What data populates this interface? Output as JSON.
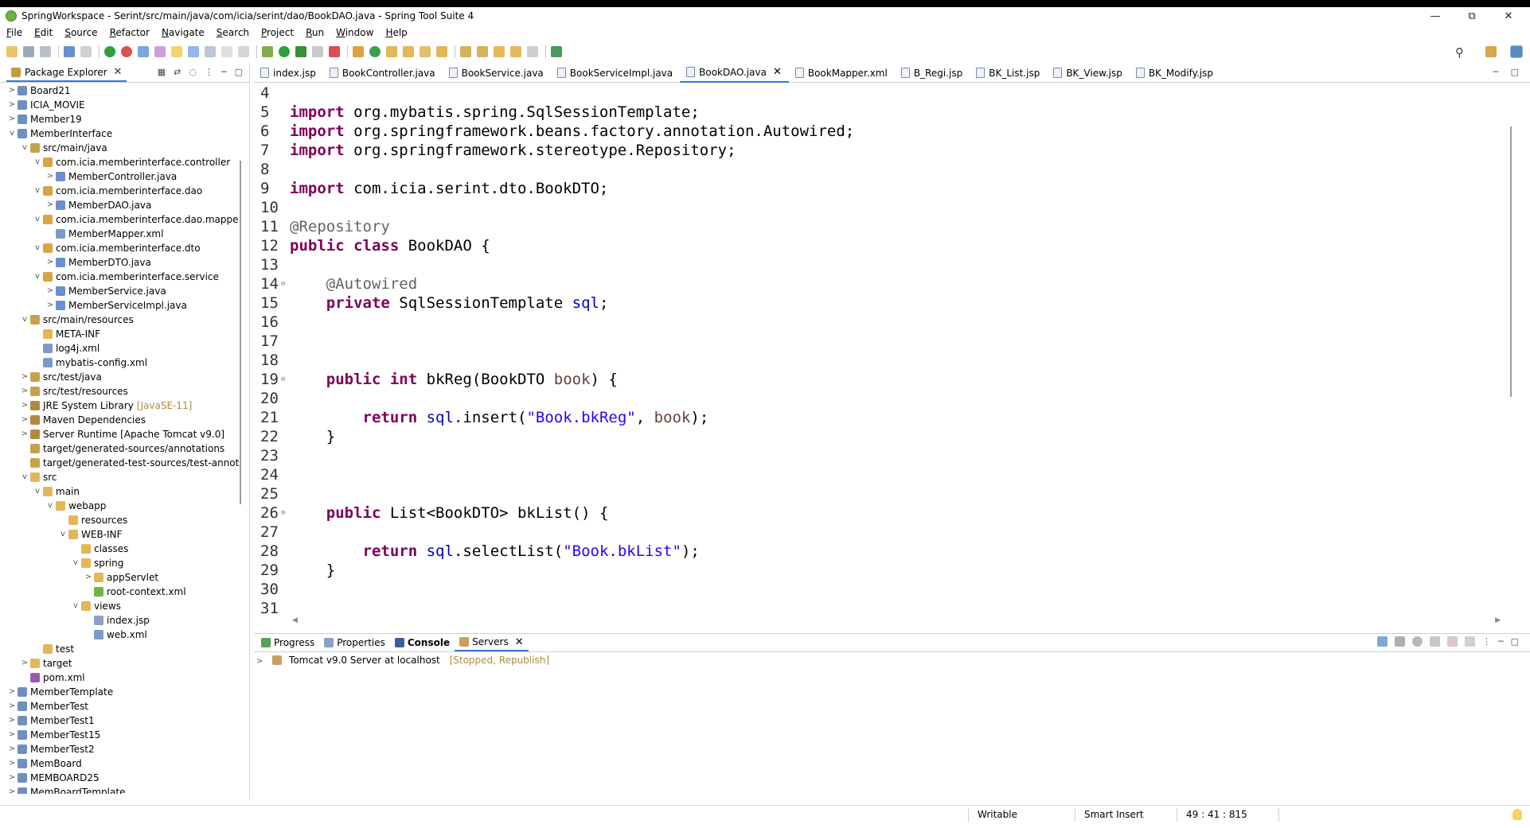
{
  "window": {
    "title": "SpringWorkspace - Serint/src/main/java/com/icia/serint/dao/BookDAO.java - Spring Tool Suite 4",
    "minimize_glyph": "—",
    "maximize_glyph": "⧉",
    "close_glyph": "✕"
  },
  "menu": [
    "File",
    "Edit",
    "Source",
    "Refactor",
    "Navigate",
    "Search",
    "Project",
    "Run",
    "Window",
    "Help"
  ],
  "package_explorer": {
    "tab_label": "Package Explorer",
    "close_glyph": "✕",
    "tree": [
      {
        "label": "Board21",
        "twisty": ">",
        "icon": "project-icon"
      },
      {
        "label": "ICIA_MOVIE",
        "twisty": ">",
        "icon": "project-icon"
      },
      {
        "label": "Member19",
        "twisty": ">",
        "icon": "project-icon"
      },
      {
        "label": "MemberInterface",
        "twisty": "v",
        "icon": "project-icon"
      },
      {
        "label": "src/main/java",
        "twisty": "v",
        "icon": "source-folder-icon"
      },
      {
        "label": "com.icia.memberinterface.controller",
        "twisty": "v",
        "icon": "package-icon"
      },
      {
        "label": "MemberController.java",
        "twisty": ">",
        "icon": "java-file-icon"
      },
      {
        "label": "com.icia.memberinterface.dao",
        "twisty": "v",
        "icon": "package-icon"
      },
      {
        "label": "MemberDAO.java",
        "twisty": ">",
        "icon": "java-file-icon"
      },
      {
        "label": "com.icia.memberinterface.dao.mapper",
        "twisty": "v",
        "icon": "package-icon"
      },
      {
        "label": "MemberMapper.xml",
        "twisty": "",
        "icon": "xml-file-icon"
      },
      {
        "label": "com.icia.memberinterface.dto",
        "twisty": "v",
        "icon": "package-icon"
      },
      {
        "label": "MemberDTO.java",
        "twisty": ">",
        "icon": "java-file-icon"
      },
      {
        "label": "com.icia.memberinterface.service",
        "twisty": "v",
        "icon": "package-icon"
      },
      {
        "label": "MemberService.java",
        "twisty": ">",
        "icon": "java-file-icon"
      },
      {
        "label": "MemberServiceImpl.java",
        "twisty": ">",
        "icon": "java-file-icon"
      },
      {
        "label": "src/main/resources",
        "twisty": "v",
        "icon": "source-folder-icon"
      },
      {
        "label": "META-INF",
        "twisty": "",
        "icon": "folder-icon"
      },
      {
        "label": "log4j.xml",
        "twisty": "",
        "icon": "xml-file-icon"
      },
      {
        "label": "mybatis-config.xml",
        "twisty": "",
        "icon": "xml-file-icon"
      },
      {
        "label": "src/test/java",
        "twisty": ">",
        "icon": "source-folder-icon"
      },
      {
        "label": "src/test/resources",
        "twisty": ">",
        "icon": "source-folder-icon"
      },
      {
        "label": "JRE System Library",
        "twisty": ">",
        "icon": "library-icon",
        "decoration": "[JavaSE-11]"
      },
      {
        "label": "Maven Dependencies",
        "twisty": ">",
        "icon": "library-icon"
      },
      {
        "label": "Server Runtime [Apache Tomcat v9.0]",
        "twisty": ">",
        "icon": "library-icon"
      },
      {
        "label": "target/generated-sources/annotations",
        "twisty": "",
        "icon": "source-folder-icon"
      },
      {
        "label": "target/generated-test-sources/test-annotatic",
        "twisty": "",
        "icon": "source-folder-icon"
      },
      {
        "label": "src",
        "twisty": "v",
        "icon": "folder-icon"
      },
      {
        "label": "main",
        "twisty": "v",
        "icon": "folder-icon"
      },
      {
        "label": "webapp",
        "twisty": "v",
        "icon": "folder-icon"
      },
      {
        "label": "resources",
        "twisty": "",
        "icon": "folder-icon"
      },
      {
        "label": "WEB-INF",
        "twisty": "v",
        "icon": "folder-icon"
      },
      {
        "label": "classes",
        "twisty": "",
        "icon": "folder-icon"
      },
      {
        "label": "spring",
        "twisty": "v",
        "icon": "folder-icon"
      },
      {
        "label": "appServlet",
        "twisty": ">",
        "icon": "folder-icon"
      },
      {
        "label": "root-context.xml",
        "twisty": "",
        "icon": "spring-xml-icon"
      },
      {
        "label": "views",
        "twisty": "v",
        "icon": "folder-icon"
      },
      {
        "label": "index.jsp",
        "twisty": "",
        "icon": "jsp-file-icon"
      },
      {
        "label": "web.xml",
        "twisty": "",
        "icon": "xml-file-icon"
      },
      {
        "label": "test",
        "twisty": "",
        "icon": "folder-icon"
      },
      {
        "label": "target",
        "twisty": ">",
        "icon": "folder-icon"
      },
      {
        "label": "pom.xml",
        "twisty": "",
        "icon": "maven-file-icon"
      },
      {
        "label": "MemberTemplate",
        "twisty": ">",
        "icon": "project-icon"
      },
      {
        "label": "MemberTest",
        "twisty": ">",
        "icon": "project-icon"
      },
      {
        "label": "MemberTest1",
        "twisty": ">",
        "icon": "project-icon"
      },
      {
        "label": "MemberTest15",
        "twisty": ">",
        "icon": "project-icon"
      },
      {
        "label": "MemberTest2",
        "twisty": ">",
        "icon": "project-icon"
      },
      {
        "label": "MemBoard",
        "twisty": ">",
        "icon": "project-icon"
      },
      {
        "label": "MEMBOARD25",
        "twisty": ">",
        "icon": "project-icon"
      },
      {
        "label": "MemBoardTemplate",
        "twisty": ">",
        "icon": "project-icon"
      }
    ]
  },
  "editor": {
    "tabs": [
      {
        "label": "index.jsp"
      },
      {
        "label": "BookController.java"
      },
      {
        "label": "BookService.java"
      },
      {
        "label": "BookServiceImpl.java"
      },
      {
        "label": "BookDAO.java",
        "active": true
      },
      {
        "label": "BookMapper.xml"
      },
      {
        "label": "B_Regi.jsp"
      },
      {
        "label": "BK_List.jsp"
      },
      {
        "label": "BK_View.jsp"
      },
      {
        "label": "BK_Modify.jsp"
      }
    ],
    "lines": [
      {
        "n": "4",
        "tokens": []
      },
      {
        "n": "5",
        "tokens": [
          {
            "t": "import",
            "c": "kw"
          },
          {
            "t": " org.mybatis.spring.SqlSessionTemplate;"
          }
        ]
      },
      {
        "n": "6",
        "tokens": [
          {
            "t": "import",
            "c": "kw"
          },
          {
            "t": " org.springframework.beans.factory.annotation.Autowired;"
          }
        ]
      },
      {
        "n": "7",
        "tokens": [
          {
            "t": "import",
            "c": "kw"
          },
          {
            "t": " org.springframework.stereotype.Repository;"
          }
        ]
      },
      {
        "n": "8",
        "tokens": []
      },
      {
        "n": "9",
        "tokens": [
          {
            "t": "import",
            "c": "kw"
          },
          {
            "t": " com.icia.serint.dto.BookDTO;"
          }
        ]
      },
      {
        "n": "10",
        "tokens": []
      },
      {
        "n": "11",
        "tokens": [
          {
            "t": "@Repository",
            "c": "ann"
          }
        ]
      },
      {
        "n": "12",
        "tokens": [
          {
            "t": "public",
            "c": "kw"
          },
          {
            "t": " "
          },
          {
            "t": "class",
            "c": "kw"
          },
          {
            "t": " BookDAO {"
          }
        ]
      },
      {
        "n": "13",
        "tokens": []
      },
      {
        "n": "14",
        "fold": true,
        "tokens": [
          {
            "t": "    "
          },
          {
            "t": "@Autowired",
            "c": "ann"
          }
        ]
      },
      {
        "n": "15",
        "tokens": [
          {
            "t": "    "
          },
          {
            "t": "private",
            "c": "kw"
          },
          {
            "t": " SqlSessionTemplate "
          },
          {
            "t": "sql",
            "c": "fld"
          },
          {
            "t": ";"
          }
        ]
      },
      {
        "n": "16",
        "tokens": []
      },
      {
        "n": "17",
        "tokens": []
      },
      {
        "n": "18",
        "tokens": []
      },
      {
        "n": "19",
        "fold": true,
        "tokens": [
          {
            "t": "    "
          },
          {
            "t": "public",
            "c": "kw"
          },
          {
            "t": " "
          },
          {
            "t": "int",
            "c": "kw"
          },
          {
            "t": " bkReg(BookDTO "
          },
          {
            "t": "book",
            "c": "prm"
          },
          {
            "t": ") {"
          }
        ]
      },
      {
        "n": "20",
        "tokens": []
      },
      {
        "n": "21",
        "tokens": [
          {
            "t": "        "
          },
          {
            "t": "return",
            "c": "kw"
          },
          {
            "t": " "
          },
          {
            "t": "sql",
            "c": "fld"
          },
          {
            "t": ".insert("
          },
          {
            "t": "\"Book.bkReg\"",
            "c": "str"
          },
          {
            "t": ", "
          },
          {
            "t": "book",
            "c": "prm"
          },
          {
            "t": ");"
          }
        ]
      },
      {
        "n": "22",
        "tokens": [
          {
            "t": "    }"
          }
        ]
      },
      {
        "n": "23",
        "tokens": []
      },
      {
        "n": "24",
        "tokens": []
      },
      {
        "n": "25",
        "tokens": []
      },
      {
        "n": "26",
        "fold": true,
        "tokens": [
          {
            "t": "    "
          },
          {
            "t": "public",
            "c": "kw"
          },
          {
            "t": " List<BookDTO> bkList() {"
          }
        ]
      },
      {
        "n": "27",
        "tokens": []
      },
      {
        "n": "28",
        "tokens": [
          {
            "t": "        "
          },
          {
            "t": "return",
            "c": "kw"
          },
          {
            "t": " "
          },
          {
            "t": "sql",
            "c": "fld"
          },
          {
            "t": ".selectList("
          },
          {
            "t": "\"Book.bkList\"",
            "c": "str"
          },
          {
            "t": ");"
          }
        ]
      },
      {
        "n": "29",
        "tokens": [
          {
            "t": "    }"
          }
        ]
      },
      {
        "n": "30",
        "tokens": []
      },
      {
        "n": "31",
        "tokens": []
      }
    ]
  },
  "bottom_panel": {
    "tabs": [
      {
        "label": "Progress",
        "icon": "progress-icon"
      },
      {
        "label": "Properties",
        "icon": "properties-icon"
      },
      {
        "label": "Console",
        "icon": "console-icon",
        "bold": true
      },
      {
        "label": "Servers",
        "icon": "servers-icon",
        "active": true,
        "closable": true
      }
    ],
    "server": {
      "name": "Tomcat v9.0 Server at localhost",
      "state": "[Stopped, Republish]"
    }
  },
  "status_bar": {
    "mode": "Writable",
    "insert_mode": "Smart Insert",
    "position": "49 : 41 : 815"
  },
  "colors": {
    "keyword": "#7f0055",
    "annotation": "#646464",
    "string": "#2a00ff",
    "field": "#0000c0",
    "parameter": "#6a3e3e",
    "active_tab_underline": "#3875d7"
  }
}
